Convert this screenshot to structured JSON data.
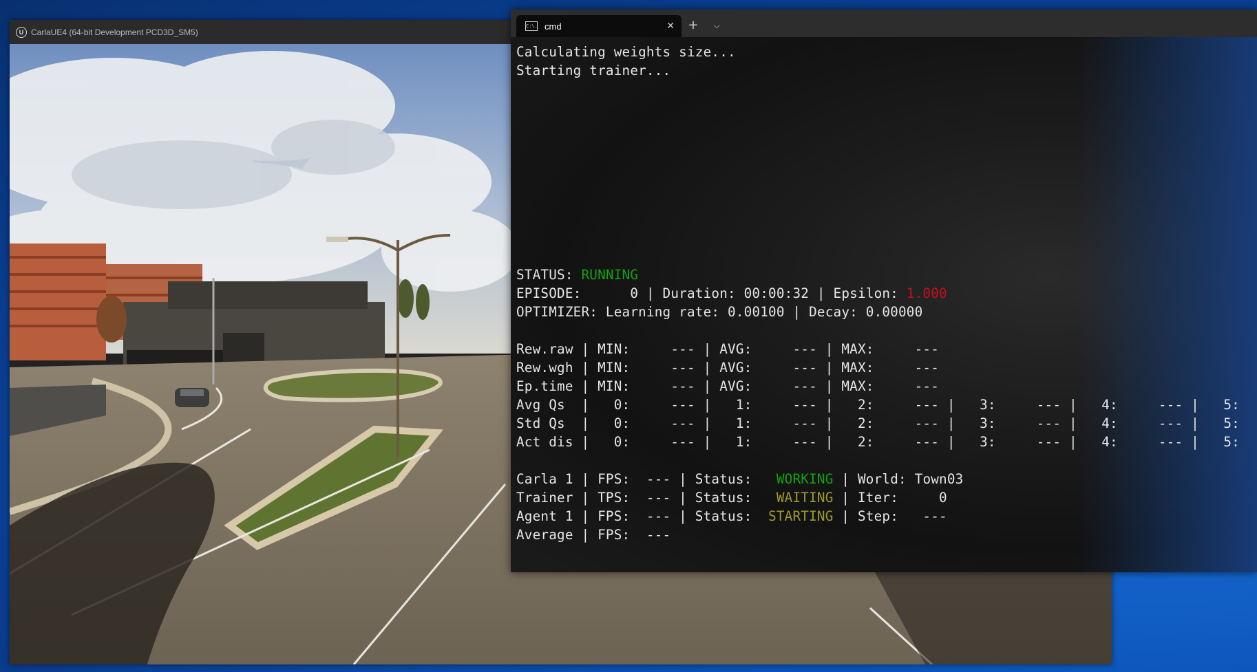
{
  "carla": {
    "title": "CarlaUE4 (64-bit Development PCD3D_SM5)",
    "logo": "U"
  },
  "terminal": {
    "tab_title": "cmd",
    "tab_icon_text": "C:\\.",
    "new_tab": "+",
    "dropdown": "⌵",
    "close": "✕",
    "line_calc": "Calculating weights size...",
    "line_start": "Starting trainer...",
    "status": {
      "label": "STATUS: ",
      "value": "RUNNING"
    },
    "episode": {
      "prefix": "EPISODE:      0 | Duration: 00:00:32 | Epsilon: ",
      "epsilon": "1.000"
    },
    "optimizer": "OPTIMIZER: Learning rate: 0.00100 | Decay: 0.00000",
    "rew_raw": "Rew.raw | MIN:     --- | AVG:     --- | MAX:     ---",
    "rew_wgh": "Rew.wgh | MIN:     --- | AVG:     --- | MAX:     ---",
    "ep_time": "Ep.time | MIN:     --- | AVG:     --- | MAX:     ---",
    "avg_qs": "Avg Qs  |   0:     --- |   1:     --- |   2:     --- |   3:     --- |   4:     --- |   5:",
    "std_qs": "Std Qs  |   0:     --- |   1:     --- |   2:     --- |   3:     --- |   4:     --- |   5:",
    "act_dis": "Act dis |   0:     --- |   1:     --- |   2:     --- |   3:     --- |   4:     --- |   5:",
    "carla1": {
      "prefix": "Carla 1 | FPS:  --- | Status:   ",
      "status": "WORKING",
      "suffix": " | World: Town03"
    },
    "trainer": {
      "prefix": "Trainer | TPS:  --- | Status:   ",
      "status": "WAITING",
      "suffix": " | Iter:     0"
    },
    "agent1": {
      "prefix": "Agent 1 | FPS:  --- | Status:  ",
      "status": "STARTING",
      "suffix": " | Step:   ---"
    },
    "average": "Average | FPS:  ---"
  },
  "colors": {
    "running": "#13a10e",
    "working": "#13a10e",
    "waiting": "#a09a2a",
    "starting": "#a09a2a",
    "epsilon": "#c50f1f"
  }
}
